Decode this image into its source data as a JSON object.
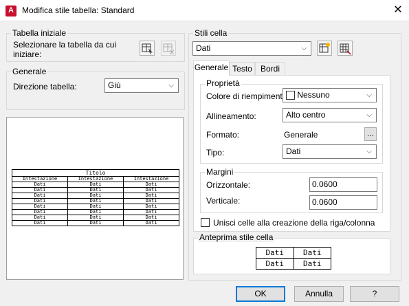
{
  "window": {
    "title": "Modifica stile tabella: Standard",
    "app_icon_letter": "A"
  },
  "starting_table": {
    "group_label": "Tabella iniziale",
    "instruction": "Selezionare la tabella da cui iniziare:"
  },
  "general": {
    "group_label": "Generale",
    "direction_label": "Direzione tabella:",
    "direction_value": "Giù"
  },
  "table_preview": {
    "title": "Titolo",
    "headers": [
      "Intestazione",
      "Intestazione",
      "Intestazione"
    ],
    "rows": [
      [
        "Dati",
        "Dati",
        "Dati"
      ],
      [
        "Dati",
        "Dati",
        "Dati"
      ],
      [
        "Dati",
        "Dati",
        "Dati"
      ],
      [
        "Dati",
        "Dati",
        "Dati"
      ],
      [
        "Dati",
        "Dati",
        "Dati"
      ],
      [
        "Dati",
        "Dati",
        "Dati"
      ],
      [
        "Dati",
        "Dati",
        "Dati"
      ],
      [
        "Dati",
        "Dati",
        "Dati"
      ]
    ]
  },
  "cell_styles": {
    "group_label": "Stili cella",
    "selected": "Dati",
    "tabs": [
      {
        "label": "Generale",
        "active": true
      },
      {
        "label": "Testo",
        "active": false
      },
      {
        "label": "Bordi",
        "active": false
      }
    ],
    "properties": {
      "group_label": "Proprietà",
      "fill_color_label": "Colore di riempimento:",
      "fill_color_value": "Nessuno",
      "alignment_label": "Allineamento:",
      "alignment_value": "Alto centro",
      "format_label": "Formato:",
      "format_value": "Generale",
      "format_button": "...",
      "type_label": "Tipo:",
      "type_value": "Dati"
    },
    "margins": {
      "group_label": "Margini",
      "horizontal_label": "Orizzontale:",
      "horizontal_value": "0.0600",
      "vertical_label": "Verticale:",
      "vertical_value": "0.0600"
    },
    "merge_label": "Unisci celle alla creazione della riga/colonna",
    "merge_checked": false,
    "preview": {
      "group_label": "Anteprima stile cella",
      "cells": [
        [
          "Dati",
          "Dati"
        ],
        [
          "Dati",
          "Dati"
        ]
      ]
    }
  },
  "buttons": {
    "ok": "OK",
    "cancel": "Annulla",
    "help": "?"
  }
}
